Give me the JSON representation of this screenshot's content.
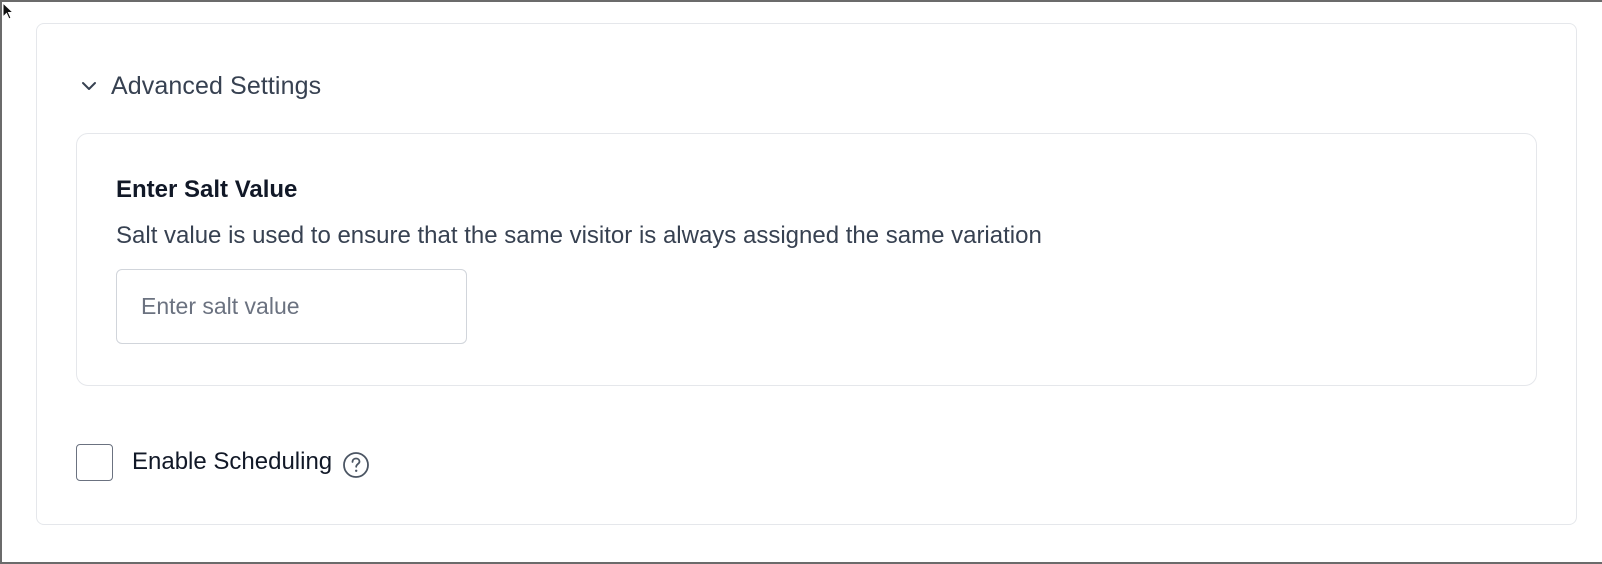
{
  "advanced_settings": {
    "title": "Advanced Settings",
    "expanded": true,
    "salt": {
      "label": "Enter Salt Value",
      "help_text": "Salt value is used to ensure that the same visitor is always assigned the same variation",
      "input_value": "",
      "input_placeholder": "Enter salt value"
    },
    "scheduling": {
      "label": "Enable Scheduling",
      "checked": false,
      "help_icon": "question-circle-icon"
    }
  },
  "icons": {
    "chevron": "chevron-down-icon",
    "cursor": "mouse-pointer-icon"
  },
  "colors": {
    "border": "#e5e7eb",
    "text_primary": "#111827",
    "text_secondary": "#374151",
    "placeholder": "#6b7280"
  }
}
